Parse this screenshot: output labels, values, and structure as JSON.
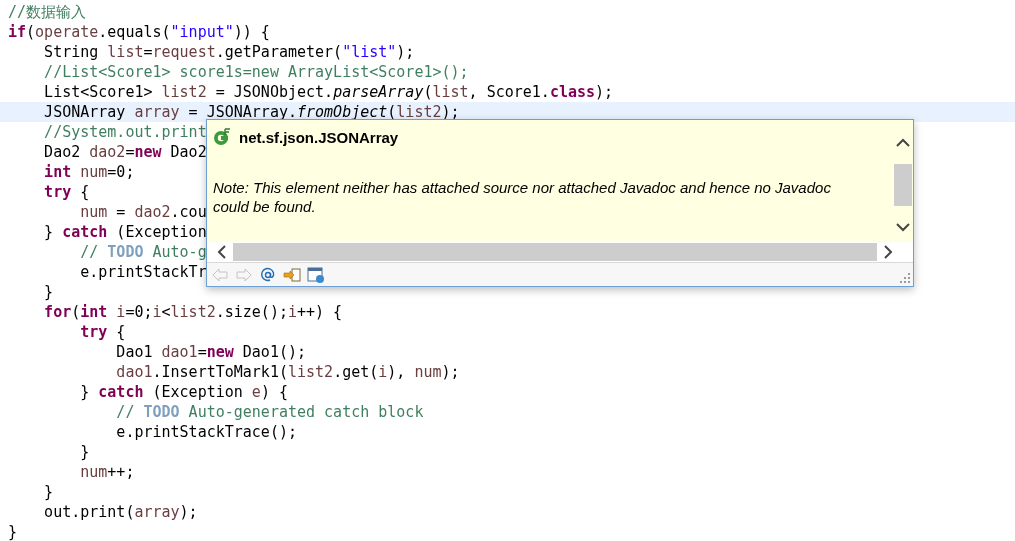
{
  "code": {
    "lines": [
      {
        "current": false,
        "tokens": [
          {
            "kind": "comment",
            "text": "//数据输入"
          }
        ]
      },
      {
        "current": false,
        "tokens": [
          {
            "kind": "keyword",
            "text": "if"
          },
          {
            "kind": "plain",
            "text": "("
          },
          {
            "kind": "variable",
            "text": "operate"
          },
          {
            "kind": "plain",
            "text": ".equals("
          },
          {
            "kind": "string",
            "text": "\"input\""
          },
          {
            "kind": "plain",
            "text": ")) {"
          }
        ]
      },
      {
        "current": false,
        "tokens": [
          {
            "kind": "plain",
            "text": "    String "
          },
          {
            "kind": "variable",
            "text": "list"
          },
          {
            "kind": "plain",
            "text": "="
          },
          {
            "kind": "variable",
            "text": "request"
          },
          {
            "kind": "plain",
            "text": ".getParameter("
          },
          {
            "kind": "string",
            "text": "\"list\""
          },
          {
            "kind": "plain",
            "text": ");"
          }
        ]
      },
      {
        "current": false,
        "tokens": [
          {
            "kind": "comment",
            "text": "    //List<Score1> score1s=new ArrayList<Score1>();"
          }
        ]
      },
      {
        "current": false,
        "tokens": [
          {
            "kind": "plain",
            "text": "    List<Score1> "
          },
          {
            "kind": "variable",
            "text": "list2"
          },
          {
            "kind": "plain",
            "text": " = JSONObject."
          },
          {
            "kind": "static",
            "text": "parseArray"
          },
          {
            "kind": "plain",
            "text": "("
          },
          {
            "kind": "variable",
            "text": "list"
          },
          {
            "kind": "plain",
            "text": ", Score1."
          },
          {
            "kind": "keyword",
            "text": "class"
          },
          {
            "kind": "plain",
            "text": ");"
          }
        ]
      },
      {
        "current": true,
        "tokens": [
          {
            "kind": "plain",
            "text": "    JSONArray "
          },
          {
            "kind": "variable",
            "text": "array"
          },
          {
            "kind": "plain",
            "text": " = JSONArray."
          },
          {
            "kind": "static",
            "text": "fromObject"
          },
          {
            "kind": "plain",
            "text": "("
          },
          {
            "kind": "variable",
            "text": "list2"
          },
          {
            "kind": "plain",
            "text": ");"
          }
        ]
      },
      {
        "current": false,
        "tokens": [
          {
            "kind": "comment",
            "text": "    //System.out.print"
          }
        ]
      },
      {
        "current": false,
        "tokens": [
          {
            "kind": "plain",
            "text": "    Dao2 "
          },
          {
            "kind": "variable",
            "text": "dao2"
          },
          {
            "kind": "plain",
            "text": "="
          },
          {
            "kind": "keyword",
            "text": "new"
          },
          {
            "kind": "plain",
            "text": " Dao2"
          }
        ]
      },
      {
        "current": false,
        "tokens": [
          {
            "kind": "keyword",
            "text": "    int"
          },
          {
            "kind": "variable",
            "text": " num"
          },
          {
            "kind": "plain",
            "text": "=0;"
          }
        ]
      },
      {
        "current": false,
        "tokens": [
          {
            "kind": "keyword",
            "text": "    try"
          },
          {
            "kind": "plain",
            "text": " {"
          }
        ]
      },
      {
        "current": false,
        "tokens": [
          {
            "kind": "variable",
            "text": "        num"
          },
          {
            "kind": "plain",
            "text": " = "
          },
          {
            "kind": "variable",
            "text": "dao2"
          },
          {
            "kind": "plain",
            "text": ".cou"
          }
        ]
      },
      {
        "current": false,
        "tokens": [
          {
            "kind": "plain",
            "text": "    } "
          },
          {
            "kind": "keyword",
            "text": "catch"
          },
          {
            "kind": "plain",
            "text": " (Exception"
          }
        ]
      },
      {
        "current": false,
        "tokens": [
          {
            "kind": "comment",
            "text": "        // "
          },
          {
            "kind": "todo",
            "text": "TODO"
          },
          {
            "kind": "comment",
            "text": " Auto-g"
          }
        ]
      },
      {
        "current": false,
        "tokens": [
          {
            "kind": "plain",
            "text": "        e.printStackTr"
          }
        ]
      },
      {
        "current": false,
        "tokens": [
          {
            "kind": "plain",
            "text": "    }"
          }
        ]
      },
      {
        "current": false,
        "tokens": [
          {
            "kind": "keyword",
            "text": "    for"
          },
          {
            "kind": "plain",
            "text": "("
          },
          {
            "kind": "keyword",
            "text": "int"
          },
          {
            "kind": "variable",
            "text": " i"
          },
          {
            "kind": "plain",
            "text": "=0;"
          },
          {
            "kind": "variable",
            "text": "i"
          },
          {
            "kind": "plain",
            "text": "<"
          },
          {
            "kind": "variable",
            "text": "list2"
          },
          {
            "kind": "plain",
            "text": ".size();"
          },
          {
            "kind": "variable",
            "text": "i"
          },
          {
            "kind": "plain",
            "text": "++) {"
          }
        ]
      },
      {
        "current": false,
        "tokens": [
          {
            "kind": "keyword",
            "text": "        try"
          },
          {
            "kind": "plain",
            "text": " {"
          }
        ]
      },
      {
        "current": false,
        "tokens": [
          {
            "kind": "plain",
            "text": "            Dao1 "
          },
          {
            "kind": "variable",
            "text": "dao1"
          },
          {
            "kind": "plain",
            "text": "="
          },
          {
            "kind": "keyword",
            "text": "new"
          },
          {
            "kind": "plain",
            "text": " Dao1();"
          }
        ]
      },
      {
        "current": false,
        "tokens": [
          {
            "kind": "variable",
            "text": "            dao1"
          },
          {
            "kind": "plain",
            "text": ".InsertToMark1("
          },
          {
            "kind": "variable",
            "text": "list2"
          },
          {
            "kind": "plain",
            "text": ".get("
          },
          {
            "kind": "variable",
            "text": "i"
          },
          {
            "kind": "plain",
            "text": "), "
          },
          {
            "kind": "variable",
            "text": "num"
          },
          {
            "kind": "plain",
            "text": ");"
          }
        ]
      },
      {
        "current": false,
        "tokens": [
          {
            "kind": "plain",
            "text": "        } "
          },
          {
            "kind": "keyword",
            "text": "catch"
          },
          {
            "kind": "plain",
            "text": " (Exception "
          },
          {
            "kind": "variable",
            "text": "e"
          },
          {
            "kind": "plain",
            "text": ") {"
          }
        ]
      },
      {
        "current": false,
        "tokens": [
          {
            "kind": "comment",
            "text": "            // "
          },
          {
            "kind": "todo",
            "text": "TODO"
          },
          {
            "kind": "comment",
            "text": " Auto-generated catch block"
          }
        ]
      },
      {
        "current": false,
        "tokens": [
          {
            "kind": "plain",
            "text": "            e.printStackTrace();"
          }
        ]
      },
      {
        "current": false,
        "tokens": [
          {
            "kind": "plain",
            "text": "        }"
          }
        ]
      },
      {
        "current": false,
        "tokens": [
          {
            "kind": "variable",
            "text": "        num"
          },
          {
            "kind": "plain",
            "text": "++;"
          }
        ]
      },
      {
        "current": false,
        "tokens": [
          {
            "kind": "plain",
            "text": "    }"
          }
        ]
      },
      {
        "current": false,
        "tokens": [
          {
            "kind": "plain",
            "text": "    out.print("
          },
          {
            "kind": "variable",
            "text": "array"
          },
          {
            "kind": "plain",
            "text": ");"
          }
        ]
      },
      {
        "current": false,
        "tokens": [
          {
            "kind": "plain",
            "text": "}"
          }
        ]
      }
    ]
  },
  "javadoc_popup": {
    "title": "net.sf.json.JSONArray",
    "note": "Note: This element neither has attached source nor attached Javadoc and hence no Javadoc could be found.",
    "toolbar": [
      {
        "kind": "back",
        "disabled": true
      },
      {
        "kind": "forward",
        "disabled": true
      },
      {
        "kind": "at",
        "disabled": false
      },
      {
        "kind": "open",
        "disabled": false
      },
      {
        "kind": "browser",
        "disabled": false
      }
    ]
  }
}
